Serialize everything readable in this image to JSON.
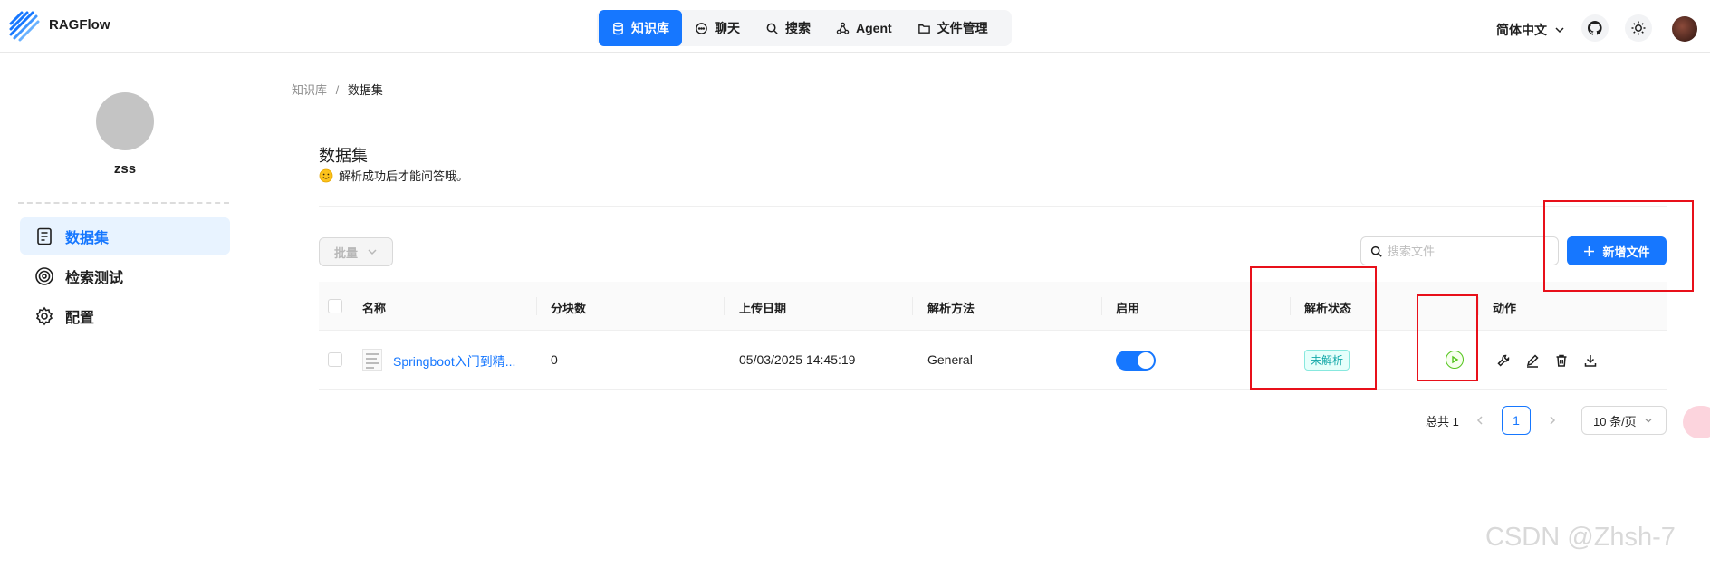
{
  "app": {
    "brand": "RAGFlow"
  },
  "nav": {
    "items": [
      {
        "label": "知识库",
        "icon": "database-icon",
        "active": true
      },
      {
        "label": "聊天",
        "icon": "chat-icon",
        "active": false
      },
      {
        "label": "搜索",
        "icon": "search-icon",
        "active": false
      },
      {
        "label": "Agent",
        "icon": "agent-icon",
        "active": false
      },
      {
        "label": "文件管理",
        "icon": "folder-icon",
        "active": false
      }
    ]
  },
  "header": {
    "language": "简体中文"
  },
  "sidebar": {
    "username": "zss",
    "items": [
      {
        "label": "数据集",
        "icon": "dataset-icon",
        "active": true
      },
      {
        "label": "检索测试",
        "icon": "target-icon",
        "active": false
      },
      {
        "label": "配置",
        "icon": "gear-icon",
        "active": false
      }
    ]
  },
  "breadcrumb": {
    "root": "知识库",
    "separator": "/",
    "current": "数据集"
  },
  "page": {
    "title": "数据集",
    "subtitle": "解析成功后才能问答哦。"
  },
  "toolbar": {
    "batch_label": "批量",
    "search_placeholder": "搜索文件",
    "add_label": "新增文件"
  },
  "table": {
    "columns": [
      "名称",
      "分块数",
      "上传日期",
      "解析方法",
      "启用",
      "解析状态",
      "动作"
    ],
    "rows": [
      {
        "name": "Springboot入门到精...",
        "chunks": "0",
        "upload_date": "05/03/2025 14:45:19",
        "parse_method": "General",
        "enabled": true,
        "status": "未解析"
      }
    ]
  },
  "pagination": {
    "total_label": "总共 1",
    "current_page": "1",
    "page_size": "10 条/页"
  },
  "watermark": "CSDN @Zhsh-7",
  "colors": {
    "accent": "#1677ff",
    "highlight": "#e8101a",
    "status_tag": "#13a8a8"
  }
}
